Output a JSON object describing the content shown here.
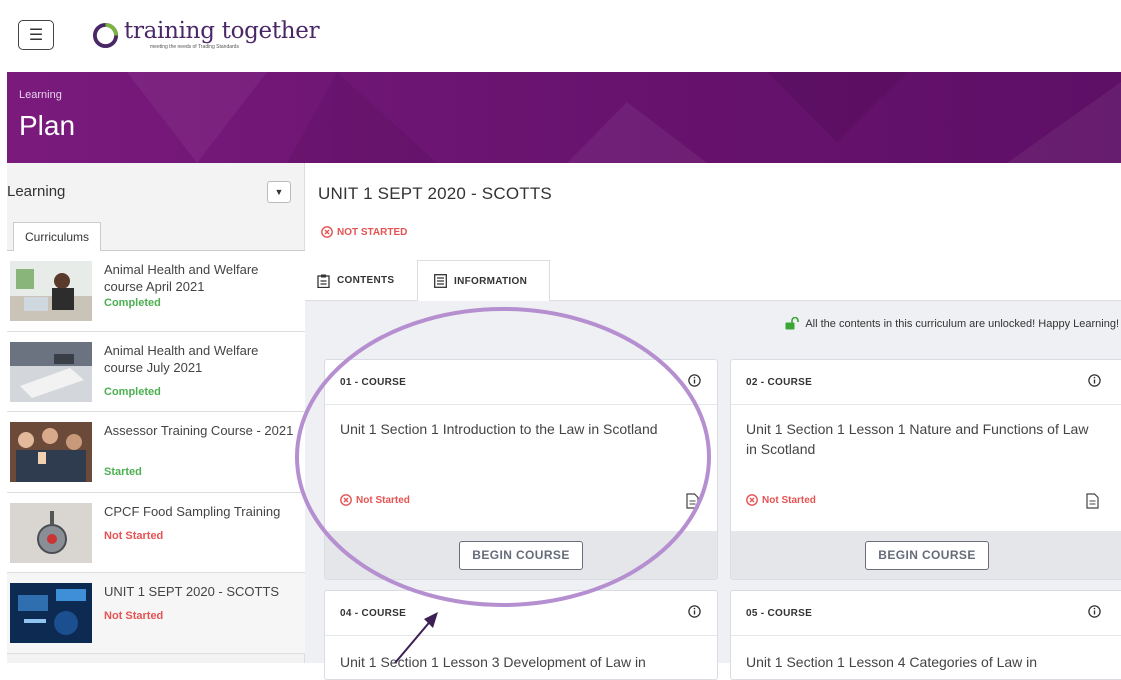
{
  "brand": {
    "name": "training together",
    "tagline": "meeting the needs of Trading Standards",
    "color": "#4a2868",
    "accent": "#7a1a7d"
  },
  "header": {
    "menu_icon": "hamburger-icon"
  },
  "banner": {
    "subtitle": "Learning",
    "title": "Plan"
  },
  "sidebar": {
    "dropdown_label": "Learning",
    "tab": "Curriculums",
    "items": [
      {
        "title": "Animal Health and Welfare course April 2021",
        "status": "Completed",
        "status_color": "#4caf50"
      },
      {
        "title": "Animal Health and Welfare course July 2021",
        "status": "Completed",
        "status_color": "#4caf50"
      },
      {
        "title": "Assessor Training Course - 2021",
        "status": "Started",
        "status_color": "#4caf50"
      },
      {
        "title": "CPCF Food Sampling Training",
        "status": "Not Started",
        "status_color": "#e55353"
      },
      {
        "title": "UNIT 1 SEPT 2020 - SCOTTS",
        "status": "Not Started",
        "status_color": "#e55353"
      }
    ]
  },
  "main": {
    "title": "UNIT 1 SEPT 2020 - SCOTTS",
    "status": "NOT STARTED",
    "tabs": [
      {
        "label": "CONTENTS"
      },
      {
        "label": "INFORMATION"
      }
    ],
    "unlock_message": "All the contents in this curriculum are unlocked! Happy Learning!",
    "cards": [
      {
        "number": "01 - COURSE",
        "title": "Unit 1 Section 1 Introduction to the Law in Scotland",
        "status": "Not Started",
        "button": "BEGIN COURSE"
      },
      {
        "number": "02 - COURSE",
        "title": "Unit 1 Section 1 Lesson 1 Nature and Functions of Law in Scotland",
        "status": "Not Started",
        "button": "BEGIN COURSE"
      },
      {
        "number": "04 - COURSE",
        "title": "Unit 1 Section 1 Lesson 3 Development of Law in"
      },
      {
        "number": "05 - COURSE",
        "title": "Unit 1 Section 1 Lesson 4 Categories of Law in"
      }
    ]
  },
  "annotation": {
    "ellipse_color": "#b58fd0",
    "arrow_color": "#3d1f55"
  }
}
